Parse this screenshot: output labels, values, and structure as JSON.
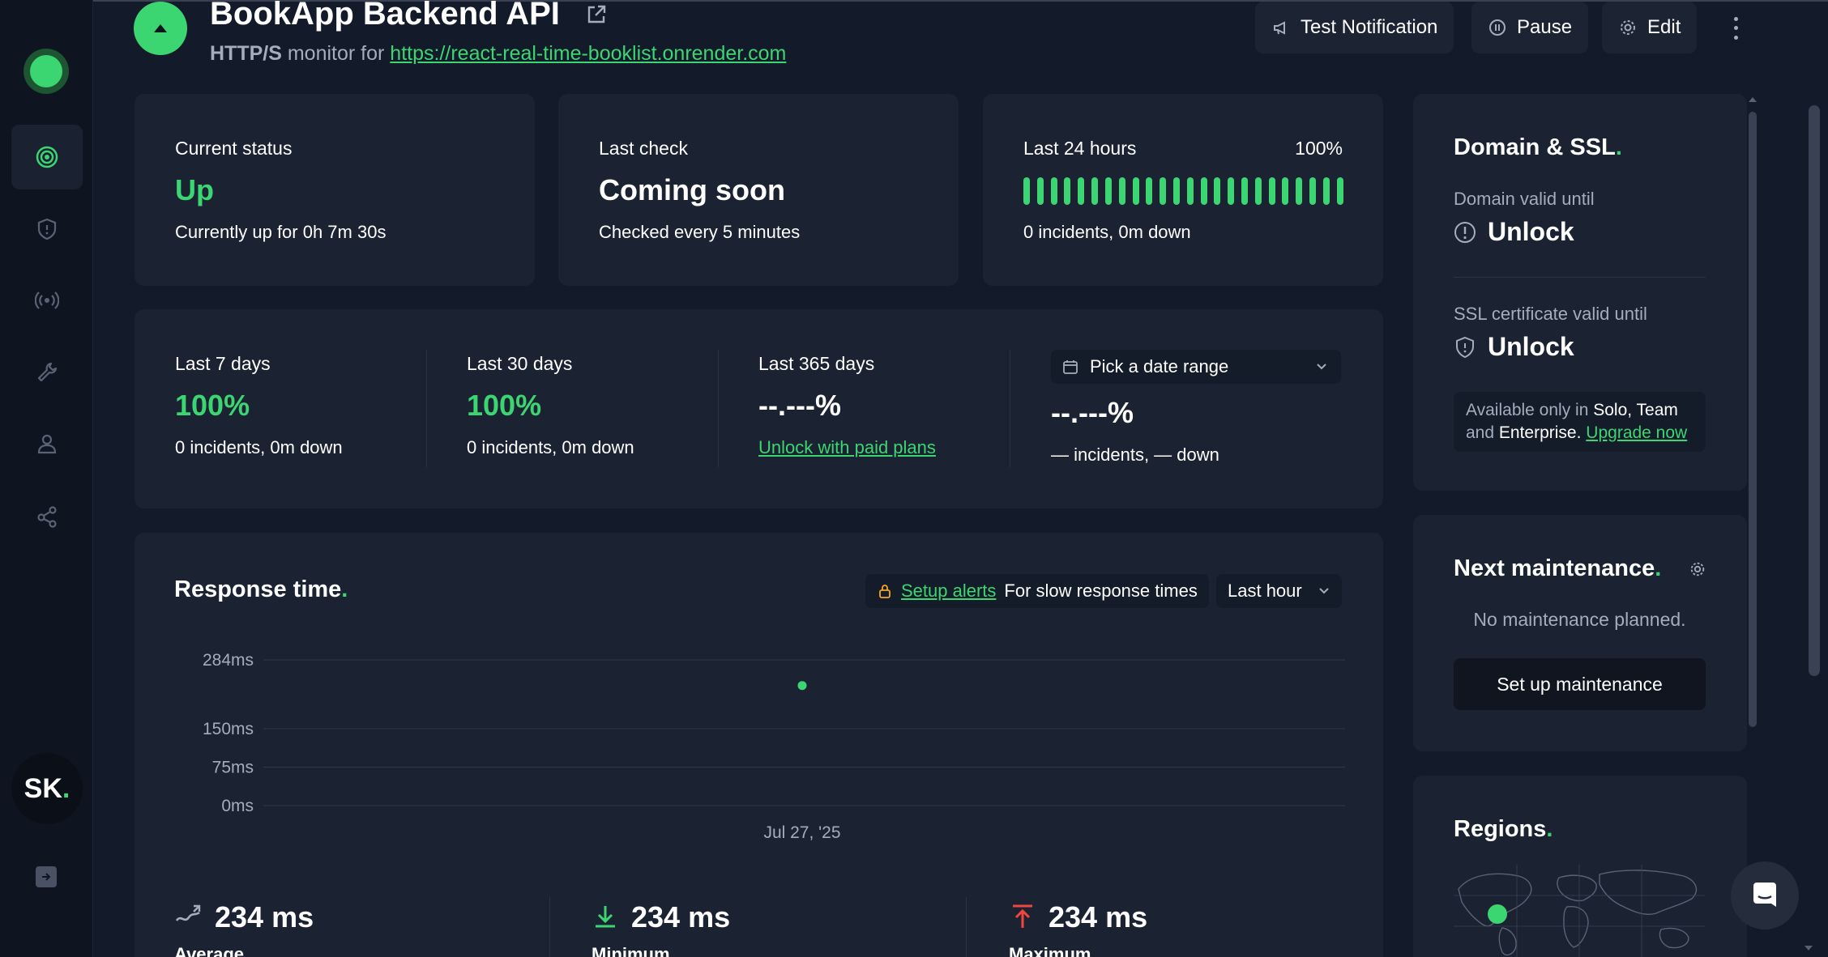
{
  "monitor": {
    "title": "BookApp Backend API",
    "protocol": "HTTP/S",
    "monitor_for": "monitor for",
    "url": "https://react-real-time-booklist.onrender.com"
  },
  "header_buttons": {
    "test_notification": "Test Notification",
    "pause": "Pause",
    "edit": "Edit"
  },
  "sidebar": {
    "avatar_initials": "SK",
    "avatar_dot": ".",
    "items": [
      "monitoring-icon",
      "shield-icon",
      "broadcast-icon",
      "wrench-icon",
      "user-icon",
      "integrations-icon"
    ]
  },
  "cards": {
    "current_status": {
      "label": "Current status",
      "value": "Up",
      "sub": "Currently up for 0h 7m 30s"
    },
    "last_check": {
      "label": "Last check",
      "value": "Coming soon",
      "sub": "Checked every 5 minutes"
    },
    "last_24h": {
      "label": "Last 24 hours",
      "percent": "100%",
      "sub": "0 incidents, 0m down",
      "bar_count": 24
    }
  },
  "periods": {
    "d7": {
      "label": "Last 7 days",
      "value": "100%",
      "sub": "0 incidents, 0m down"
    },
    "d30": {
      "label": "Last 30 days",
      "value": "100%",
      "sub": "0 incidents, 0m down"
    },
    "d365": {
      "label": "Last 365 days",
      "value": "--.---%",
      "link": "Unlock with paid plans"
    },
    "custom": {
      "picker": "Pick a date range",
      "value": "--.---%",
      "sub": "— incidents, — down"
    }
  },
  "response_time": {
    "title": "Response time",
    "title_dot": ".",
    "alert_link": "Setup alerts",
    "alert_text": "For slow response times",
    "range": "Last hour",
    "stats": {
      "average": {
        "value": "234 ms",
        "label": "Average"
      },
      "minimum": {
        "value": "234 ms",
        "label": "Minimum"
      },
      "maximum": {
        "value": "234 ms",
        "label": "Maximum"
      }
    }
  },
  "chart_data": {
    "type": "scatter",
    "y_ticks": [
      "284ms",
      "150ms",
      "75ms",
      "0ms"
    ],
    "x_ticks": [
      "Jul 27, '25"
    ],
    "points": [
      {
        "x": "Jul 27, '25",
        "y": 234
      }
    ],
    "ylim": [
      0,
      284
    ],
    "grid": true,
    "colors": {
      "point": "#3bd671",
      "grid": "#2d3546"
    }
  },
  "domain_ssl": {
    "title": "Domain & SSL",
    "title_dot": ".",
    "domain_label": "Domain valid until",
    "domain_value": "Unlock",
    "ssl_label": "SSL certificate valid until",
    "ssl_value": "Unlock",
    "avail_prefix": "Available only in",
    "avail_plan1": "Solo, Team",
    "avail_and": "and",
    "avail_plan2": "Enterprise",
    "avail_period": ".",
    "upgrade": "Upgrade now"
  },
  "maintenance": {
    "title": "Next maintenance",
    "title_dot": ".",
    "empty": "No maintenance planned.",
    "button": "Set up maintenance"
  },
  "regions": {
    "title": "Regions",
    "title_dot": "."
  },
  "colors": {
    "accent": "#3bd671",
    "background": "#131a2a",
    "card": "#1b2232",
    "sidebar": "#0f1520"
  }
}
